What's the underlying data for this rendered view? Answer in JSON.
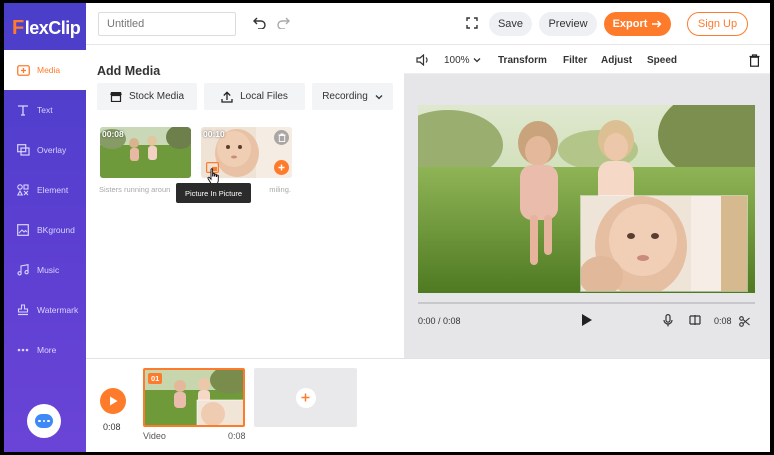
{
  "app": {
    "logo_first": "F",
    "logo_rest": "lexClip"
  },
  "sidebar": {
    "items": [
      {
        "label": "Media",
        "icon": "media-icon",
        "active": true
      },
      {
        "label": "Text",
        "icon": "text-icon"
      },
      {
        "label": "Overlay",
        "icon": "overlay-icon"
      },
      {
        "label": "Element",
        "icon": "element-icon"
      },
      {
        "label": "BKground",
        "icon": "background-icon"
      },
      {
        "label": "Music",
        "icon": "music-icon"
      },
      {
        "label": "Watermark",
        "icon": "watermark-icon"
      },
      {
        "label": "More",
        "icon": "more-icon"
      }
    ]
  },
  "topbar": {
    "title_placeholder": "Untitled",
    "save": "Save",
    "preview": "Preview",
    "export": "Export",
    "signup": "Sign Up"
  },
  "media_panel": {
    "title": "Add Media",
    "stock": "Stock Media",
    "local": "Local Files",
    "recording": "Recording",
    "thumb1_duration": "00:08",
    "thumb2_duration": "00:10",
    "caption": "Sisters running aroun",
    "caption_tail": "miling.",
    "tooltip": "Picture In Picture"
  },
  "editbar": {
    "zoom": "100%",
    "transform": "Transform",
    "filter": "Filter",
    "adjust": "Adjust",
    "speed": "Speed"
  },
  "player": {
    "time": "0:00 / 0:08",
    "duration": "0:08",
    "progress": 0
  },
  "timeline": {
    "time": "0:08",
    "clip_number": "01",
    "clip_label": "Video",
    "clip_duration": "0:08"
  },
  "colors": {
    "accent": "#ff7b2c",
    "sidebar": "#5040cc"
  }
}
